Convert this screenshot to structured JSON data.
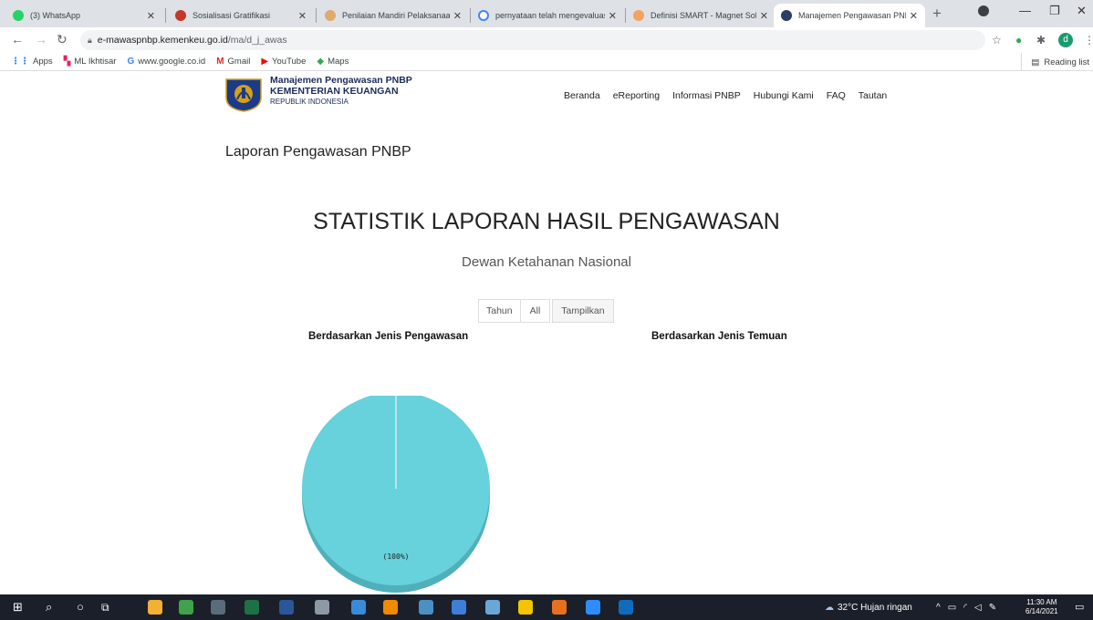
{
  "tabs": [
    {
      "title": "(3) WhatsApp",
      "favicon": "whatsapp-icon",
      "color": "#25d366"
    },
    {
      "title": "Sosialisasi Gratifikasi",
      "favicon": "site-icon",
      "color": "#c0392b"
    },
    {
      "title": "Penilaian Mandiri Pelaksanaan",
      "favicon": "site-icon",
      "color": "#e0a96d"
    },
    {
      "title": "pernyataan telah mengevaluasi",
      "favicon": "google-icon",
      "color": "#4285f4"
    },
    {
      "title": "Definisi SMART - Magnet Solu",
      "favicon": "link-icon",
      "color": "#f4a261"
    },
    {
      "title": "Manajemen Pengawasan PNB",
      "favicon": "kemenkeu-icon",
      "color": "#2a3d66"
    }
  ],
  "omnibox": {
    "domain": "e-mawaspnbp.kemenkeu.go.id",
    "path": "/ma/d_j_awas"
  },
  "bookmarks": [
    {
      "label": "Apps",
      "icon": "apps-icon",
      "color": "#1a73e8"
    },
    {
      "label": "ML Ikhtisar",
      "icon": "ml-icon",
      "color": "#e91e63"
    },
    {
      "label": "www.google.co.id",
      "icon": "google-icon",
      "color": "#4285f4"
    },
    {
      "label": "Gmail",
      "icon": "gmail-icon",
      "color": "#d93025"
    },
    {
      "label": "YouTube",
      "icon": "youtube-icon",
      "color": "#ff0000"
    },
    {
      "label": "Maps",
      "icon": "maps-icon",
      "color": "#34a853"
    }
  ],
  "reading_list": "Reading list",
  "profile_initial": "d",
  "header": {
    "brand_line1": "Manajemen Pengawasan PNBP",
    "brand_line2": "KEMENTERIAN KEUANGAN",
    "brand_line3": "REPUBLIK INDONESIA",
    "nav": [
      "Beranda",
      "eReporting",
      "Informasi PNBP",
      "Hubungi Kami",
      "FAQ",
      "Tautan"
    ]
  },
  "main": {
    "report_title": "Laporan Pengawasan PNBP",
    "stat_title": "STATISTIK LAPORAN HASIL PENGAWASAN",
    "org_name": "Dewan Ketahanan Nasional",
    "filter": {
      "label": "Tahun",
      "value": "All",
      "button": "Tampilkan"
    },
    "left_subtitle": "Berdasarkan Jenis Pengawasan",
    "right_subtitle": "Berdasarkan Jenis Temuan"
  },
  "chart_data": {
    "type": "pie",
    "slices": [
      {
        "label": "(100%)",
        "value": 100,
        "color": "#67d1dc"
      }
    ]
  },
  "taskbar": {
    "weather": "32°C  Hujan ringan",
    "time": "11:30 AM",
    "date": "6/14/2021"
  },
  "colors": {
    "accent": "#67d1dc",
    "shadow": "#4fb0bb",
    "taskbar": "#1b1f2a"
  }
}
